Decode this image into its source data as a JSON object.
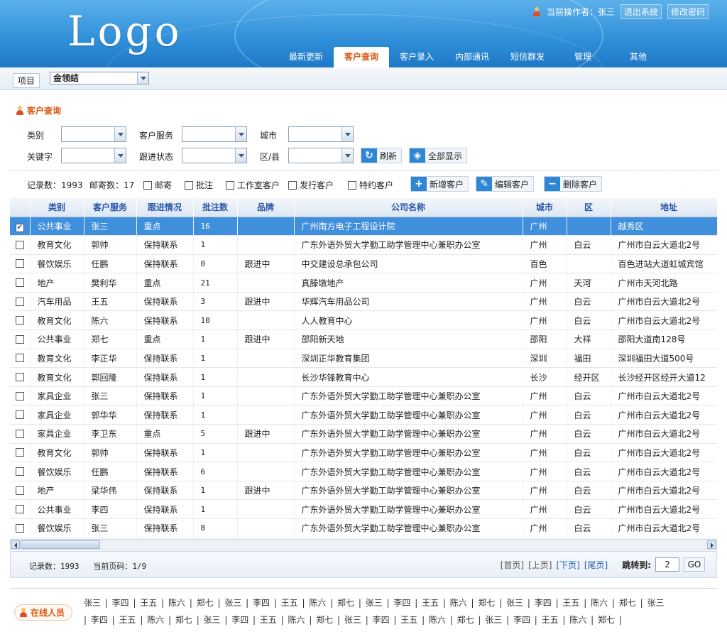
{
  "header": {
    "logo": "Logo",
    "operator_label": "当前操作者：张三",
    "logout": "退出系统",
    "change_password": "修改密码",
    "tabs": [
      "最新更新",
      "客户查询",
      "客户录入",
      "内部通讯",
      "短信群发",
      "管理",
      "其他"
    ],
    "active_tab": "客户查询"
  },
  "project": {
    "label": "项目",
    "selected": "金领结"
  },
  "section_title": "客户查询",
  "filters": {
    "category": "类别",
    "customer_service": "客户服务",
    "city": "城市",
    "keyword": "关键字",
    "follow_status": "跟进状态",
    "district": "区/县",
    "refresh": "刷新",
    "show_all": "全部显示"
  },
  "toolbar": {
    "records": "记录数：1993",
    "mailed": "邮寄数：17",
    "checks": [
      "邮寄",
      "批注",
      "工作室客户",
      "发行客户",
      "特约客户"
    ],
    "add": "新增客户",
    "edit": "编辑客户",
    "delete": "删除客户"
  },
  "table": {
    "headers": [
      "类别",
      "客户服务",
      "跟进情况",
      "批注数",
      "品牌",
      "公司名称",
      "城市",
      "区",
      "地址"
    ],
    "rows": [
      {
        "c": "公共事业",
        "s": "张三",
        "f": "重点",
        "n": "16",
        "b": "",
        "co": "广州南方电子工程设计院",
        "city": "广州",
        "d": "",
        "a": "越秀区",
        "checked": true
      },
      {
        "c": "教育文化",
        "s": "郭帅",
        "f": "保持联系",
        "n": "1",
        "b": "",
        "co": "广东外语外贸大学勤工助学管理中心兼职办公室",
        "city": "广州",
        "d": "白云",
        "a": "广州市白云大道北2号",
        "checked": false
      },
      {
        "c": "餐饮娱乐",
        "s": "任鹏",
        "f": "保持联系",
        "n": "0",
        "b": "跟进中",
        "co": "中交建设总承包公司",
        "city": "百色",
        "d": "",
        "a": "百色进站大道虹城宾馆",
        "checked": false
      },
      {
        "c": "地产",
        "s": "樊利华",
        "f": "重点",
        "n": "21",
        "b": "",
        "co": "真滕墩地产",
        "city": "广州",
        "d": "天河",
        "a": "广州市天河北路",
        "checked": false
      },
      {
        "c": "汽车用品",
        "s": "王五",
        "f": "保持联系",
        "n": "3",
        "b": "跟进中",
        "co": "华辉汽车用品公司",
        "city": "广州",
        "d": "白云",
        "a": "广州市白云大道北2号",
        "checked": false
      },
      {
        "c": "教育文化",
        "s": "陈六",
        "f": "保持联系",
        "n": "10",
        "b": "",
        "co": "人人教育中心",
        "city": "广州",
        "d": "白云",
        "a": "广州市白云大道北2号",
        "checked": false
      },
      {
        "c": "公共事业",
        "s": "郑七",
        "f": "重点",
        "n": "1",
        "b": "跟进中",
        "co": "邵阳新天地",
        "city": "邵阳",
        "d": "大祥",
        "a": "邵阳大道南128号",
        "checked": false
      },
      {
        "c": "教育文化",
        "s": "李正华",
        "f": "保持联系",
        "n": "1",
        "b": "",
        "co": "深圳正华教育集团",
        "city": "深圳",
        "d": "福田",
        "a": "深圳福田大道500号",
        "checked": false
      },
      {
        "c": "教育文化",
        "s": "郭回隆",
        "f": "保持联系",
        "n": "1",
        "b": "",
        "co": "长沙华锋教育中心",
        "city": "长沙",
        "d": "经开区",
        "a": "长沙经开区经开大道12",
        "checked": false
      },
      {
        "c": "家具企业",
        "s": "张三",
        "f": "保持联系",
        "n": "1",
        "b": "",
        "co": "广东外语外贸大学勤工助学管理中心兼职办公室",
        "city": "广州",
        "d": "白云",
        "a": "广州市白云大道北2号",
        "checked": false
      },
      {
        "c": "家具企业",
        "s": "郭华华",
        "f": "保持联系",
        "n": "1",
        "b": "",
        "co": "广东外语外贸大学勤工助学管理中心兼职办公室",
        "city": "广州",
        "d": "白云",
        "a": "广州市白云大道北2号",
        "checked": false
      },
      {
        "c": "家具企业",
        "s": "李卫东",
        "f": "重点",
        "n": "5",
        "b": "跟进中",
        "co": "广东外语外贸大学勤工助学管理中心兼职办公室",
        "city": "广州",
        "d": "白云",
        "a": "广州市白云大道北2号",
        "checked": false
      },
      {
        "c": "教育文化",
        "s": "郭帅",
        "f": "保持联系",
        "n": "1",
        "b": "",
        "co": "广东外语外贸大学勤工助学管理中心兼职办公室",
        "city": "广州",
        "d": "白云",
        "a": "广州市白云大道北2号",
        "checked": false
      },
      {
        "c": "餐饮娱乐",
        "s": "任鹏",
        "f": "保持联系",
        "n": "6",
        "b": "",
        "co": "广东外语外贸大学勤工助学管理中心兼职办公室",
        "city": "广州",
        "d": "白云",
        "a": "广州市白云大道北2号",
        "checked": false
      },
      {
        "c": "地产",
        "s": "梁华伟",
        "f": "保持联系",
        "n": "1",
        "b": "跟进中",
        "co": "广东外语外贸大学勤工助学管理中心兼职办公室",
        "city": "广州",
        "d": "白云",
        "a": "广州市白云大道北2号",
        "checked": false
      },
      {
        "c": "公共事业",
        "s": "李四",
        "f": "保持联系",
        "n": "1",
        "b": "",
        "co": "广东外语外贸大学勤工助学管理中心兼职办公室",
        "city": "广州",
        "d": "白云",
        "a": "广州市白云大道北2号",
        "checked": false
      },
      {
        "c": "餐饮娱乐",
        "s": "张三",
        "f": "保持联系",
        "n": "8",
        "b": "",
        "co": "广东外语外贸大学勤工助学管理中心兼职办公室",
        "city": "广州",
        "d": "白云",
        "a": "广州市白云大道北2号",
        "checked": false
      }
    ]
  },
  "footer": {
    "records": "记录数：1993",
    "page": "当前页码：1/9",
    "first": "[首页]",
    "prev": "[上页]",
    "next": "[下页]",
    "last": "[尾页]",
    "jump_label": "跳转到:",
    "jump_value": "2",
    "go": "GO"
  },
  "online": {
    "label": "在线人员",
    "line1": "张三 | 李四 | 王五 | 陈六 | 郑七 | 张三 | 李四 | 王五 | 陈六 | 郑七 | 张三 | 李四 | 王五 | 陈六 | 郑七 | 张三 | 李四 | 王五 | 陈六 | 郑七 | 张三",
    "line2": "| 李四 | 王五 | 陈六 | 郑七 | 张三 | 李四 | 王五 | 陈六 | 郑七 | 张三 | 李四 | 王五 | 陈六 | 郑七 | 张三 | 李四 | 王五 | 陈六 | 郑七 |"
  }
}
